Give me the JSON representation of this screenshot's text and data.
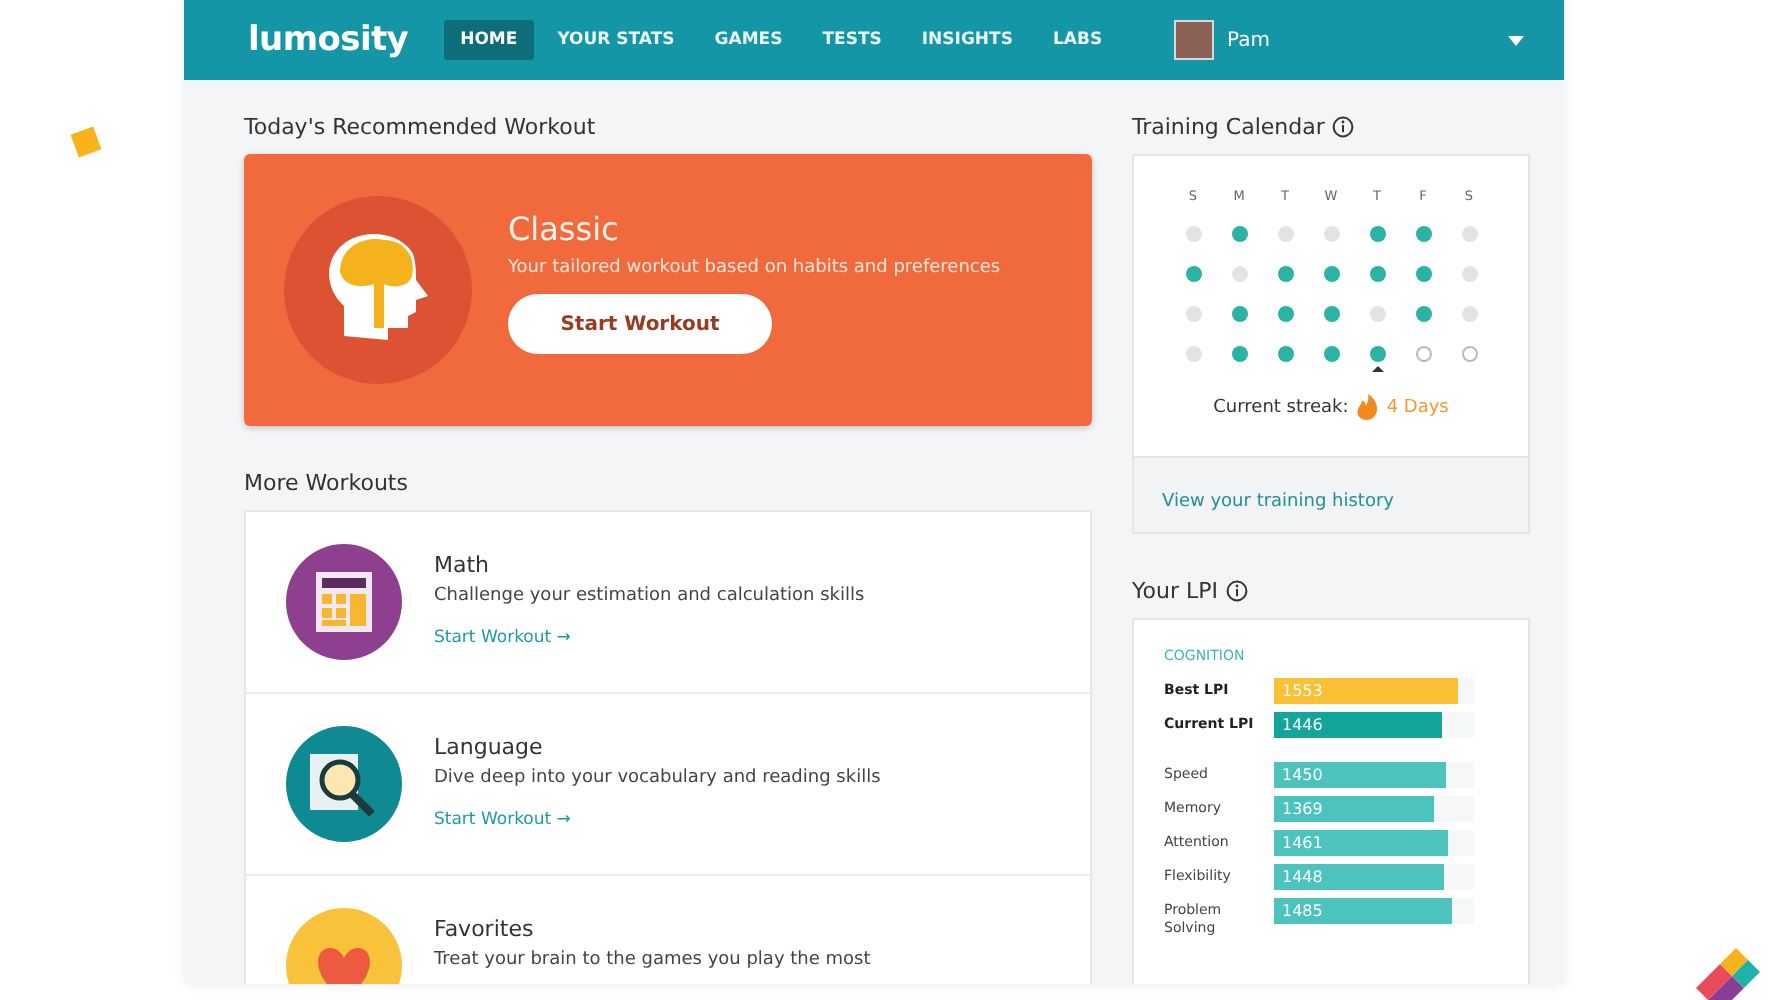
{
  "nav": {
    "logo": "lumosity",
    "tabs": [
      {
        "label": "HOME",
        "selected": true
      },
      {
        "label": "YOUR STATS",
        "selected": false
      },
      {
        "label": "GAMES",
        "selected": false
      },
      {
        "label": "TESTS",
        "selected": false
      },
      {
        "label": "INSIGHTS",
        "selected": false
      },
      {
        "label": "LABS",
        "selected": false
      }
    ],
    "user": {
      "name": "Pam"
    }
  },
  "recommended": {
    "heading": "Today's Recommended Workout",
    "title": "Classic",
    "description": "Your tailored workout based on habits and preferences",
    "button": "Start Workout"
  },
  "more_workouts": {
    "heading": "More Workouts",
    "items": [
      {
        "kind": "math",
        "title": "Math",
        "description": "Challenge your estimation and calculation skills",
        "link": "Start Workout →"
      },
      {
        "kind": "language",
        "title": "Language",
        "description": "Dive deep into your vocabulary and reading skills",
        "link": "Start Workout →"
      },
      {
        "kind": "favorites",
        "title": "Favorites",
        "description": "Treat your brain to the games you play the most"
      }
    ]
  },
  "training_calendar": {
    "heading": "Training Calendar",
    "weekdays": [
      "S",
      "M",
      "T",
      "W",
      "T",
      "F",
      "S"
    ],
    "weeks": [
      [
        {
          "kind": "past",
          "trained": false,
          "today": false
        },
        {
          "kind": "past",
          "trained": true,
          "today": false
        },
        {
          "kind": "past",
          "trained": false,
          "today": false
        },
        {
          "kind": "past",
          "trained": false,
          "today": false
        },
        {
          "kind": "past",
          "trained": true,
          "today": false
        },
        {
          "kind": "past",
          "trained": true,
          "today": false
        },
        {
          "kind": "past",
          "trained": false,
          "today": false
        }
      ],
      [
        {
          "kind": "past",
          "trained": true,
          "today": false
        },
        {
          "kind": "past",
          "trained": false,
          "today": false
        },
        {
          "kind": "past",
          "trained": true,
          "today": false
        },
        {
          "kind": "past",
          "trained": true,
          "today": false
        },
        {
          "kind": "past",
          "trained": true,
          "today": false
        },
        {
          "kind": "past",
          "trained": true,
          "today": false
        },
        {
          "kind": "past",
          "trained": false,
          "today": false
        }
      ],
      [
        {
          "kind": "past",
          "trained": false,
          "today": false
        },
        {
          "kind": "past",
          "trained": true,
          "today": false
        },
        {
          "kind": "past",
          "trained": true,
          "today": false
        },
        {
          "kind": "past",
          "trained": true,
          "today": false
        },
        {
          "kind": "past",
          "trained": false,
          "today": false
        },
        {
          "kind": "past",
          "trained": true,
          "today": false
        },
        {
          "kind": "past",
          "trained": false,
          "today": false
        }
      ],
      [
        {
          "kind": "past",
          "trained": false,
          "today": false
        },
        {
          "kind": "past",
          "trained": true,
          "today": false
        },
        {
          "kind": "past",
          "trained": true,
          "today": false
        },
        {
          "kind": "past",
          "trained": true,
          "today": false
        },
        {
          "kind": "past",
          "trained": true,
          "today": true
        },
        {
          "kind": "future",
          "trained": false,
          "today": false
        },
        {
          "kind": "future",
          "trained": false,
          "today": false
        }
      ]
    ],
    "streak_label": "Current streak:",
    "streak_value": "4 Days",
    "history_link": "View your training history"
  },
  "lpi": {
    "heading": "Your LPI",
    "section": "COGNITION",
    "scores": [
      {
        "kind": "summary",
        "label": "Best LPI",
        "value": "1553",
        "level": 0.92,
        "color": "#f9c133"
      },
      {
        "kind": "summary",
        "label": "Current LPI",
        "value": "1446",
        "level": 0.84,
        "color": "#13a59c"
      },
      {
        "kind": "area",
        "label": "Speed",
        "value": "1450",
        "level": 0.86,
        "color": "#4cc4bd"
      },
      {
        "kind": "area",
        "label": "Memory",
        "value": "1369",
        "level": 0.8,
        "color": "#4cc4bd"
      },
      {
        "kind": "area",
        "label": "Attention",
        "value": "1461",
        "level": 0.87,
        "color": "#4cc4bd"
      },
      {
        "kind": "area",
        "label": "Flexibility",
        "value": "1448",
        "level": 0.85,
        "color": "#4cc4bd"
      },
      {
        "kind": "area",
        "label": "Problem Solving",
        "value": "1485",
        "level": 0.89,
        "color": "#4cc4bd"
      }
    ]
  }
}
